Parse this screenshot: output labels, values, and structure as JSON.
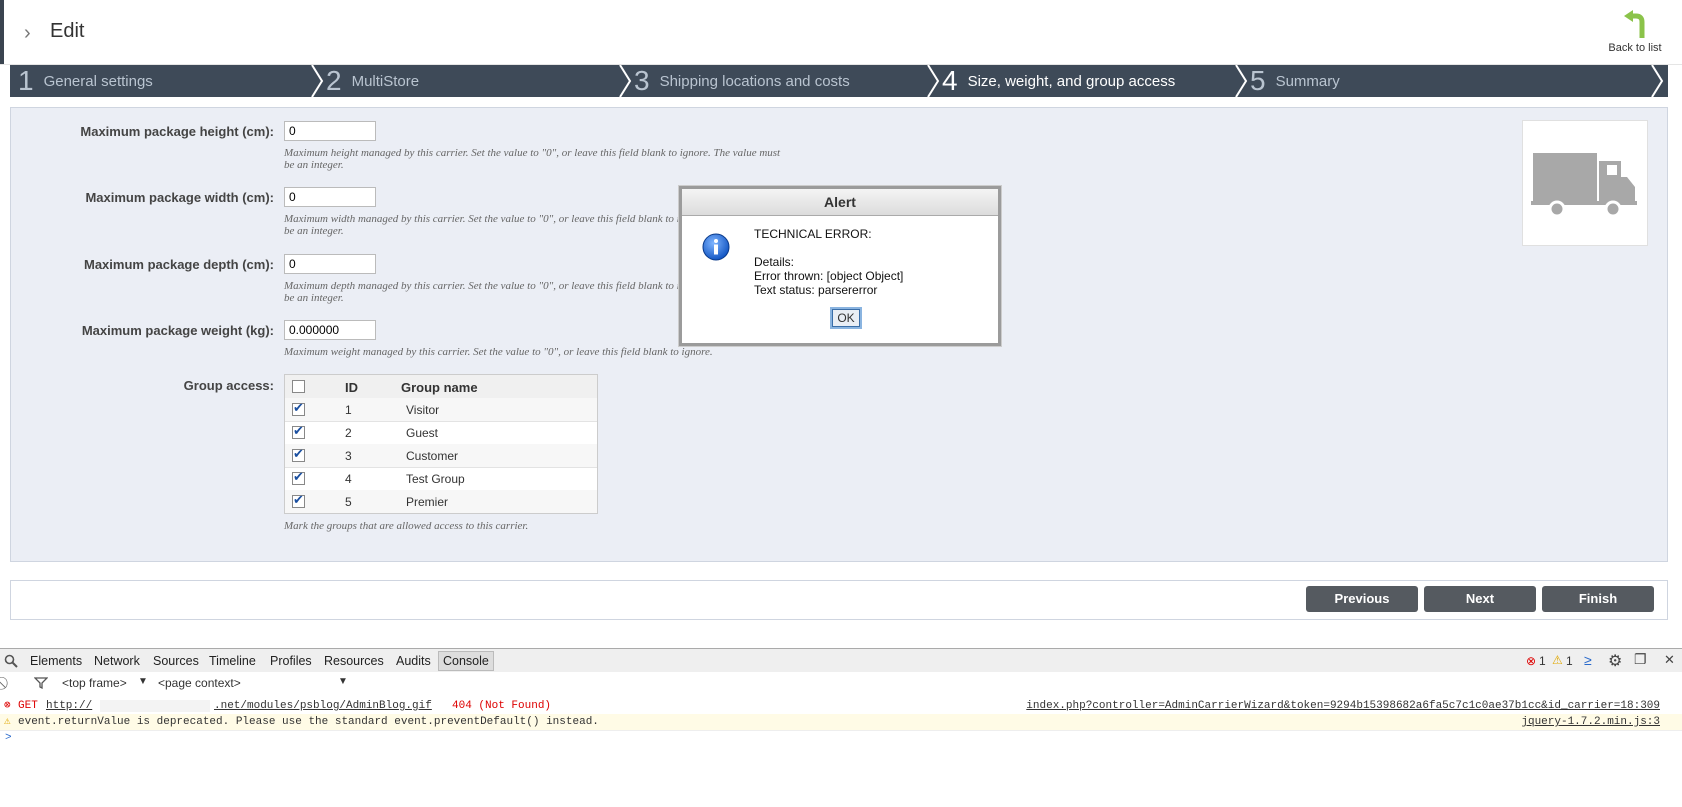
{
  "header": {
    "title": "Edit",
    "back_label": "Back to list"
  },
  "wizard": {
    "steps": [
      {
        "num": "1",
        "label": "General settings"
      },
      {
        "num": "2",
        "label": "MultiStore"
      },
      {
        "num": "3",
        "label": "Shipping locations and costs"
      },
      {
        "num": "4",
        "label": "Size, weight, and group access"
      },
      {
        "num": "5",
        "label": "Summary"
      }
    ]
  },
  "form": {
    "height": {
      "label": "Maximum package height (cm):",
      "value": "0",
      "hint": "Maximum height managed by this carrier. Set the value to \"0\", or leave this field blank to ignore. The value must be an integer."
    },
    "width": {
      "label": "Maximum package width (cm):",
      "value": "0",
      "hint": "Maximum width managed by this carrier. Set the value to \"0\", or leave this field blank to ignore. The value must be an integer."
    },
    "depth": {
      "label": "Maximum package depth (cm):",
      "value": "0",
      "hint": "Maximum depth managed by this carrier. Set the value to \"0\", or leave this field blank to ignore. The value must be an integer."
    },
    "weight": {
      "label": "Maximum package weight (kg):",
      "value": "0.000000",
      "hint": "Maximum weight managed by this carrier. Set the value to \"0\", or leave this field blank to ignore."
    },
    "group_access": {
      "label": "Group access:",
      "col_id": "ID",
      "col_name": "Group name",
      "rows": [
        {
          "id": "1",
          "name": "Visitor"
        },
        {
          "id": "2",
          "name": "Guest"
        },
        {
          "id": "3",
          "name": "Customer"
        },
        {
          "id": "4",
          "name": "Test Group"
        },
        {
          "id": "5",
          "name": "Premier"
        }
      ],
      "hint": "Mark the groups that are allowed access to this carrier."
    }
  },
  "buttons": {
    "previous": "Previous",
    "next": "Next",
    "finish": "Finish"
  },
  "alert": {
    "title": "Alert",
    "line1": "TECHNICAL ERROR:",
    "line2": "Details:",
    "line3": "Error thrown: [object Object]",
    "line4": "Text status: parsererror",
    "ok": "OK"
  },
  "devtools": {
    "tabs": [
      "Elements",
      "Network",
      "Sources",
      "Timeline",
      "Profiles",
      "Resources",
      "Audits",
      "Console"
    ],
    "active_tab": "Console",
    "frame": "<top frame>",
    "context": "<page context>",
    "error_count": "1",
    "warning_count": "1",
    "messages": [
      {
        "prefix": "GET",
        "url_start": "http://",
        "url_end": ".net/modules/psblog/AdminBlog.gif",
        "status": "404 (Not Found)",
        "source": "index.php?controller=AdminCarrierWizard&token=9294b15398682a6fa5c7c1c0ae37b1cc&id_carrier=18:309"
      },
      {
        "text": "event.returnValue is deprecated. Please use the standard event.preventDefault() instead.",
        "source": "jquery-1.7.2.min.js:3"
      }
    ],
    "prompt": ">"
  }
}
